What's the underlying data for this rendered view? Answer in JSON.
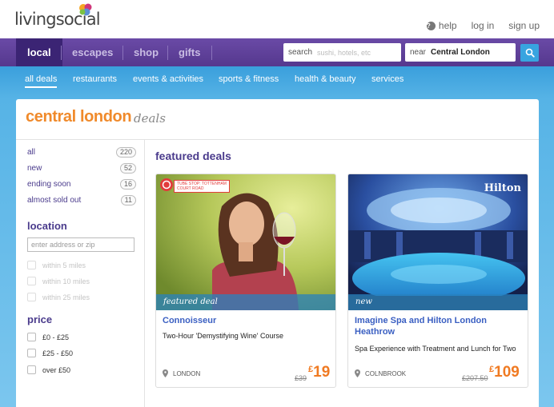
{
  "header": {
    "logo": "livingsocial",
    "links": {
      "help": "help",
      "login": "log in",
      "signup": "sign up"
    }
  },
  "nav": {
    "tabs": [
      "local",
      "escapes",
      "shop",
      "gifts"
    ],
    "active_tab": "local",
    "search_label": "search",
    "search_placeholder": "sushi, hotels, etc",
    "near_label": "near",
    "near_value": "Central London"
  },
  "subnav": {
    "items": [
      "all deals",
      "restaurants",
      "events & activities",
      "sports & fitness",
      "health & beauty",
      "services"
    ],
    "active": "all deals"
  },
  "page": {
    "title": "central london",
    "title_suffix": "deals"
  },
  "sidebar": {
    "filters": [
      {
        "label": "all",
        "count": "220"
      },
      {
        "label": "new",
        "count": "52"
      },
      {
        "label": "ending soon",
        "count": "16"
      },
      {
        "label": "almost sold out",
        "count": "11"
      }
    ],
    "location_heading": "location",
    "location_placeholder": "enter address or zip",
    "distances": [
      "within 5 miles",
      "within 10 miles",
      "within 25 miles"
    ],
    "price_heading": "price",
    "prices": [
      "£0 - £25",
      "£25 - £50",
      "over £50"
    ]
  },
  "featured": {
    "heading": "featured deals",
    "deals": [
      {
        "tag": "featured deal",
        "badge": "TUBE STOP: TOTTENHAM COURT ROAD",
        "title": "Connoisseur",
        "description": "Two-Hour 'Demystifying Wine' Course",
        "location": "LONDON",
        "old_price": "£39",
        "price_currency": "£",
        "price": "19"
      },
      {
        "tag": "new",
        "brand": "Hilton",
        "title": "Imagine Spa and Hilton London Heathrow",
        "description": "Spa Experience with Treatment and Lunch for Two",
        "location": "COLNBROOK",
        "old_price": "£207.50",
        "price_currency": "£",
        "price": "109"
      }
    ]
  },
  "colors": {
    "nav_purple": "#55388e",
    "accent_orange": "#f08a2b",
    "link_blue": "#3a5fc2",
    "sky_blue": "#3a9fdc"
  }
}
